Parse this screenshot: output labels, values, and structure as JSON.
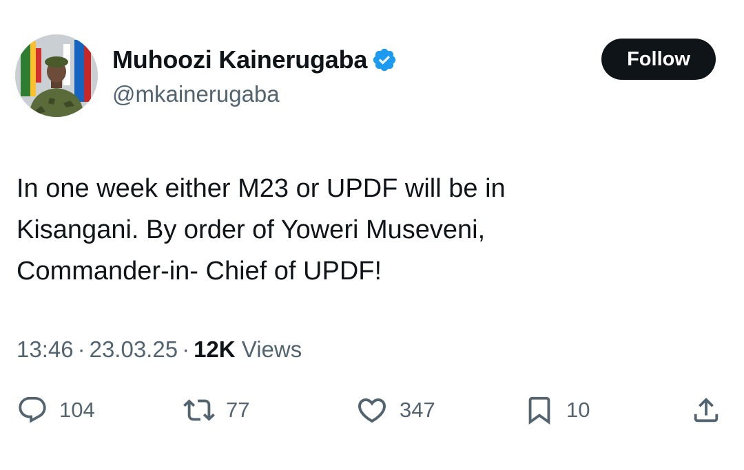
{
  "tweet": {
    "author": {
      "display_name": "Muhoozi Kainerugaba",
      "handle": "@mkainerugaba",
      "verified": true,
      "avatar_icon": "profile-photo"
    },
    "follow_label": "Follow",
    "text_lines": [
      "In one week either M23 or UPDF will be in",
      "Kisangani. By order of Yoweri Museveni,",
      "Commander-in- Chief of UPDF!"
    ],
    "meta": {
      "time": "13:46",
      "date": "23.03.25",
      "separator": "·",
      "views_count": "12K",
      "views_label": "Views"
    },
    "actions": {
      "replies": "104",
      "reposts": "77",
      "likes": "347",
      "bookmarks": "10"
    }
  },
  "colors": {
    "text": "#0f1419",
    "secondary": "#536471",
    "verified": "#1d9bf0",
    "button_bg": "#0f1419"
  }
}
